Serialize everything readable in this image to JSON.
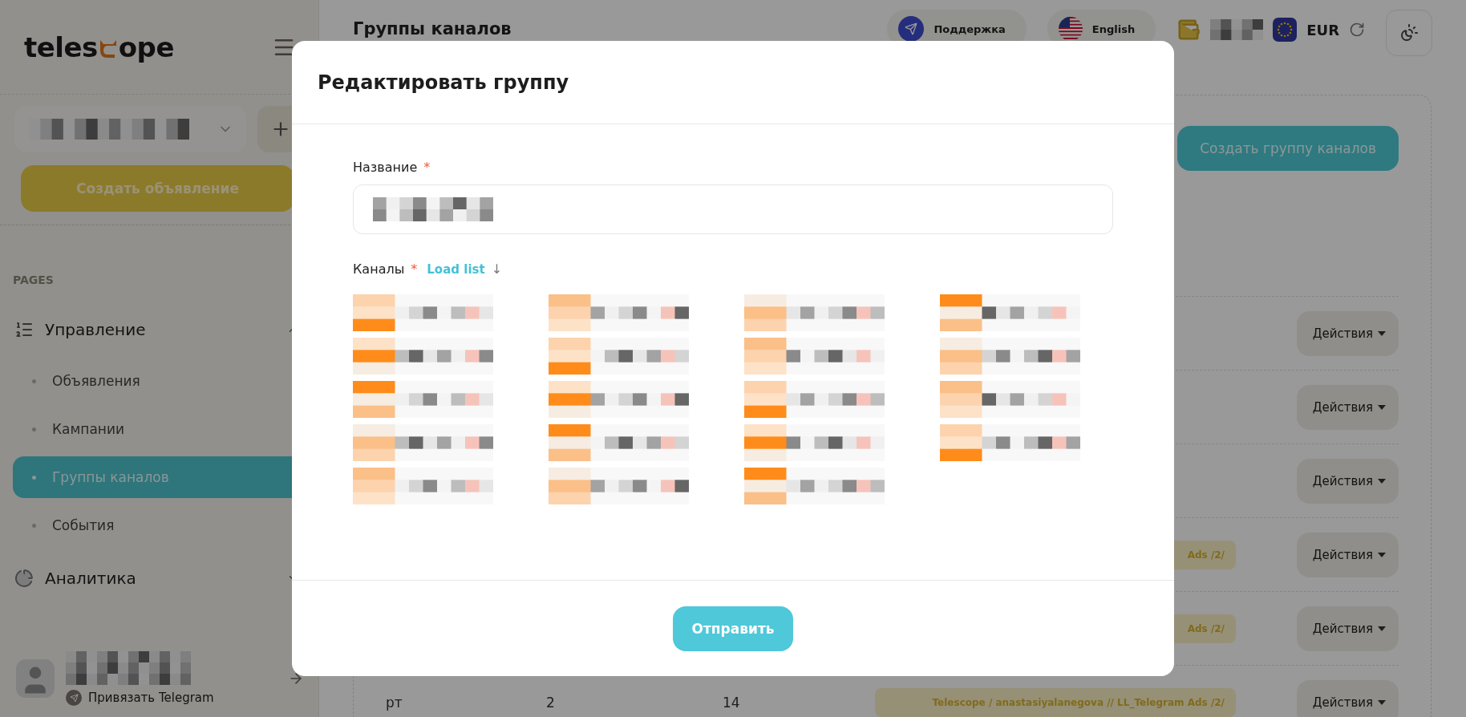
{
  "sidebar": {
    "logo": {
      "before": "teles",
      "after": "ope"
    },
    "account_selector": {
      "kind": "redacted"
    },
    "create_button": "Создать объявление",
    "section_label": "PAGES",
    "groups": [
      {
        "label": "Управление",
        "expanded": true,
        "children": [
          {
            "label": "Объявления",
            "selected": false
          },
          {
            "label": "Кампании",
            "selected": false
          },
          {
            "label": "Группы каналов",
            "selected": true
          },
          {
            "label": "События",
            "selected": false
          }
        ]
      },
      {
        "label": "Аналитика",
        "expanded": false
      }
    ],
    "user": {
      "kind": "redacted",
      "link": "Привязать Telegram"
    }
  },
  "header": {
    "title": "Группы каналов",
    "support": "Поддержка",
    "language": "English",
    "balance": {
      "kind": "redacted"
    },
    "currency": "EUR"
  },
  "content": {
    "create_button": "Создать группу каналов",
    "rows": [
      {
        "action": "Действия"
      },
      {
        "action": "Действия"
      },
      {
        "action": "Действия"
      },
      {
        "tag": "Ads /2/",
        "action": "Действия"
      },
      {
        "tag": "Ads /2/",
        "action": "Действия"
      },
      {
        "col_1": "рт",
        "col_2": "2",
        "col_3": "14",
        "tag": "Telescope / anastasiyalanegova // LL_Telegram Ads /2/",
        "action": "Действия"
      }
    ]
  },
  "modal": {
    "title": "Редактировать группу",
    "name_label": "Название",
    "name_required": "*",
    "name_field": {
      "kind": "redacted"
    },
    "channels_label": "Каналы",
    "channels_required": "*",
    "load_link": "Load list",
    "load_arrow": "↓",
    "channels": [
      {
        "kind": "redacted"
      },
      {
        "kind": "redacted"
      },
      {
        "kind": "redacted"
      },
      {
        "kind": "redacted"
      },
      {
        "kind": "redacted"
      },
      {
        "kind": "redacted"
      },
      {
        "kind": "redacted"
      },
      {
        "kind": "redacted"
      },
      {
        "kind": "redacted"
      },
      {
        "kind": "redacted"
      },
      {
        "kind": "redacted"
      },
      {
        "kind": "redacted"
      },
      {
        "kind": "redacted"
      },
      {
        "kind": "redacted"
      },
      {
        "kind": "redacted"
      },
      {
        "kind": "redacted"
      },
      {
        "kind": "redacted"
      },
      {
        "kind": "redacted"
      },
      {
        "kind": "redacted"
      }
    ],
    "submit": "Отправить"
  }
}
